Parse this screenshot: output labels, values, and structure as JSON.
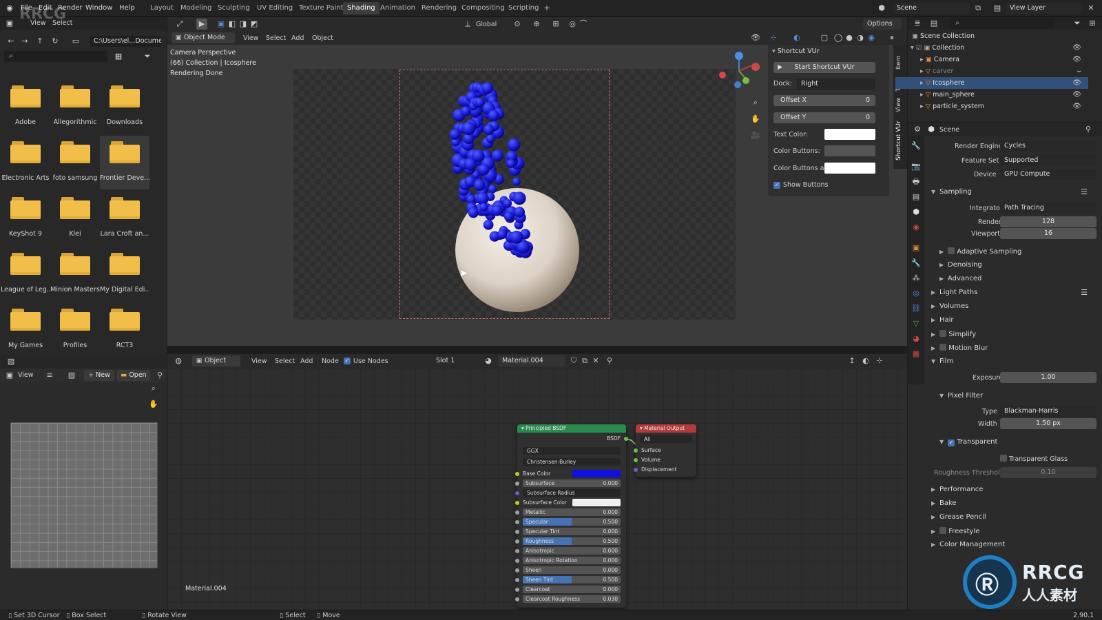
{
  "app": {
    "logo_text": "RRCG"
  },
  "menubar": [
    "File",
    "Edit",
    "Render",
    "Window",
    "Help"
  ],
  "workspace_tabs": [
    "Layout",
    "Modeling",
    "Sculpting",
    "UV Editing",
    "Texture Paint",
    "Shading",
    "Animation",
    "Rendering",
    "Compositing",
    "Scripting"
  ],
  "active_workspace": "Shading",
  "scene_field": "Scene",
  "view_layer_field": "View Layer",
  "file_browser": {
    "menu": [
      "View",
      "Select"
    ],
    "path": "C:\\Users\\el...Document\\",
    "folders": [
      "Adobe",
      "Allegorithmic",
      "Downloads",
      "Electronic Arts",
      "foto samsung",
      "Frontier Deve...",
      "KeyShot 9",
      "Klei",
      "Lara Croft an...",
      "League of Leg...",
      "Minion Masters",
      "My Digital Edi...",
      "My Games",
      "Profiles",
      "RCT3"
    ]
  },
  "image_editor": {
    "view_label": "View",
    "new_label": "New",
    "open_label": "Open"
  },
  "viewport": {
    "mode": "Object Mode",
    "menu": [
      "View",
      "Select",
      "Add",
      "Object"
    ],
    "transform": "Global",
    "options": "Options",
    "info_lines": [
      "Camera Perspective",
      "(66) Collection | Icosphere",
      "Rendering Done"
    ],
    "side_tabs": [
      "Item",
      "Tool",
      "View",
      "Shortcut VUr"
    ]
  },
  "shortcut_panel": {
    "title": "Shortcut VUr",
    "start_button": "Start Shortcut VUr",
    "dock_label": "Dock:",
    "dock_value": "Right",
    "offset_x_label": "Offset X",
    "offset_x_value": "0",
    "offset_y_label": "Offset Y",
    "offset_y_value": "0",
    "text_color_label": "Text Color:",
    "color_buttons_label": "Color Buttons:",
    "color_buttons_ac_label": "Color Buttons ac...",
    "show_buttons_label": "Show Buttons"
  },
  "node_editor": {
    "type": "Object",
    "menu": [
      "View",
      "Select",
      "Add",
      "Node"
    ],
    "use_nodes": "Use Nodes",
    "slot": "Slot 1",
    "material": "Material.004",
    "material_label": "Material.004"
  },
  "bsdf_node": {
    "title": "Principled BSDF",
    "output": "BSDF",
    "distribution": "GGX",
    "subsurface_method": "Christensen-Burley",
    "base_color_label": "Base Color",
    "subsurface_radius": "Subsurface Radius",
    "subsurface_color": "Subsurface Color",
    "rows": [
      {
        "label": "Subsurface",
        "value": "0.000",
        "fill": 0.0
      },
      {
        "label": "Metallic",
        "value": "0.000",
        "fill": 0.0
      },
      {
        "label": "Specular",
        "value": "0.500",
        "fill": 0.5
      },
      {
        "label": "Specular Tint",
        "value": "0.000",
        "fill": 0.0
      },
      {
        "label": "Roughness",
        "value": "0.500",
        "fill": 0.5
      },
      {
        "label": "Anisotropic",
        "value": "0.000",
        "fill": 0.0
      },
      {
        "label": "Anisotropic Rotation",
        "value": "0.000",
        "fill": 0.0
      },
      {
        "label": "Sheen",
        "value": "0.000",
        "fill": 0.0
      },
      {
        "label": "Sheen Tint",
        "value": "0.500",
        "fill": 0.5
      },
      {
        "label": "Clearcoat",
        "value": "0.000",
        "fill": 0.0
      },
      {
        "label": "Clearcoat Roughness",
        "value": "0.030",
        "fill": 0.03
      }
    ]
  },
  "output_node": {
    "title": "Material Output",
    "target": "All",
    "inputs": [
      "Surface",
      "Volume",
      "Displacement"
    ]
  },
  "outliner": {
    "root": "Scene Collection",
    "collection": "Collection",
    "items": [
      "Camera",
      "carver",
      "Icosphere",
      "main_sphere",
      "particle_system"
    ],
    "selected": "Icosphere"
  },
  "properties": {
    "header": "Scene",
    "render_engine_label": "Render Engine",
    "render_engine": "Cycles",
    "feature_set_label": "Feature Set",
    "feature_set": "Supported",
    "device_label": "Device",
    "device": "GPU Compute",
    "sampling": "Sampling",
    "integrator_label": "Integrator",
    "integrator": "Path Tracing",
    "render_label": "Render",
    "render_samples": "128",
    "viewport_label": "Viewport",
    "viewport_samples": "16",
    "adaptive_sampling": "Adaptive Sampling",
    "denoising": "Denoising",
    "advanced": "Advanced",
    "light_paths": "Light Paths",
    "volumes": "Volumes",
    "hair": "Hair",
    "simplify": "Simplify",
    "motion_blur": "Motion Blur",
    "film": "Film",
    "exposure_label": "Exposure",
    "exposure": "1.00",
    "pixel_filter": "Pixel Filter",
    "type_label": "Type",
    "filter_type": "Blackman-Harris",
    "width_label": "Width",
    "filter_width": "1.50 px",
    "transparent": "Transparent",
    "transparent_glass": "Transparent Glass",
    "roughness_threshold_label": "Roughness Threshold",
    "roughness_threshold": "0.10",
    "performance": "Performance",
    "bake": "Bake",
    "grease_pencil": "Grease Pencil",
    "freestyle": "Freestyle",
    "color_management": "Color Management"
  },
  "statusbar": {
    "items": [
      "Set 3D Cursor",
      "Box Select",
      "Rotate View",
      "Select",
      "Move"
    ],
    "version": "2.90.1"
  },
  "watermark": {
    "text": "RRCG",
    "cn_text": "人人素材"
  },
  "colors": {
    "accent": "#4772b3",
    "base_color": "#1010e0",
    "bsdf_header": "#2b8a4e",
    "output_header": "#b13a3a"
  }
}
